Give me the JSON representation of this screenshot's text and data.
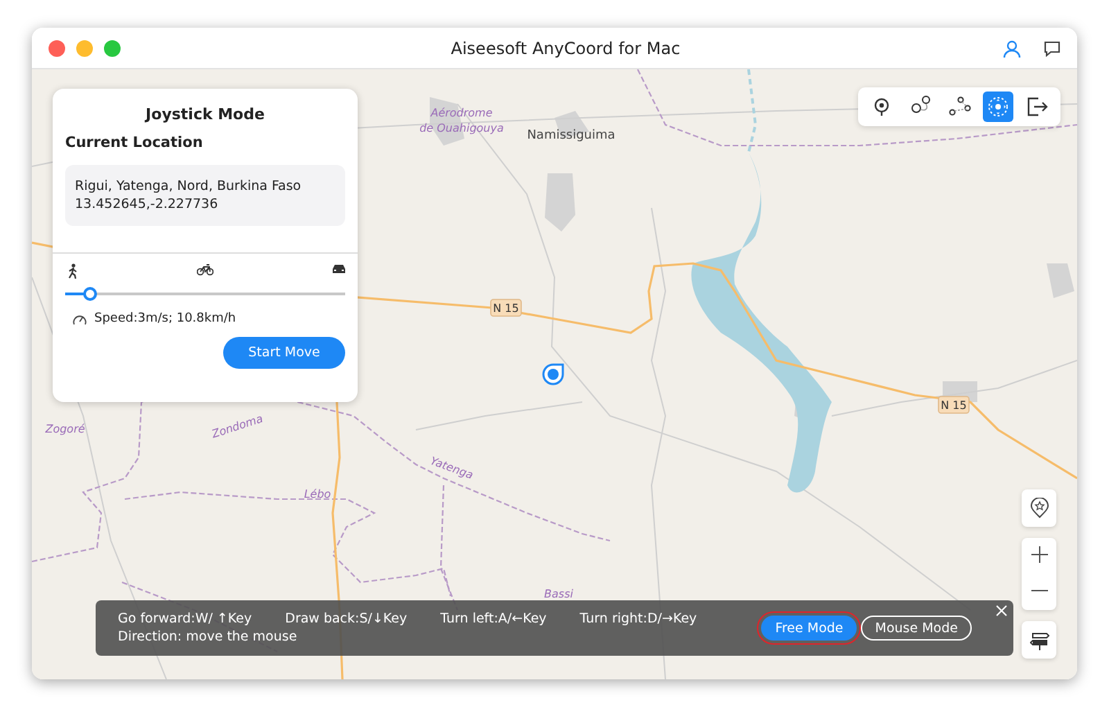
{
  "window": {
    "title": "Aiseesoft AnyCoord for Mac"
  },
  "map": {
    "labels": [
      {
        "kind": "region",
        "text": "Aérodrome"
      },
      {
        "kind": "region",
        "text": "de Ouahigouya"
      },
      {
        "kind": "place",
        "text": "Namissiguima"
      },
      {
        "kind": "shield",
        "text": "N 15"
      },
      {
        "kind": "shield",
        "text": "N 15"
      },
      {
        "kind": "region",
        "text": "Zogoré"
      },
      {
        "kind": "region",
        "text": "Zondoma"
      },
      {
        "kind": "region",
        "text": "Lébo"
      },
      {
        "kind": "region",
        "text": "Yatenga"
      },
      {
        "kind": "region",
        "text": "Bassi"
      }
    ]
  },
  "toolbar": {
    "tools": [
      {
        "selected": false
      },
      {
        "selected": false
      },
      {
        "selected": false
      },
      {
        "selected": true
      },
      {
        "selected": false
      }
    ]
  },
  "joystick_panel": {
    "title": "Joystick Mode",
    "heading": "Current Location",
    "address": "Rigui, Yatenga, Nord, Burkina Faso",
    "coordinates": "13.452645,-2.227736",
    "speed_slider": {
      "level": 0.09
    },
    "speed_text": "Speed:3m/s; 10.8km/h",
    "start_button": "Start Move"
  },
  "hint_bar": {
    "hints": [
      "Go forward:W/ ↑Key",
      "Draw back:S/↓Key",
      "Turn left:A/←Key",
      "Turn right:D/→Key"
    ],
    "direction": "Direction: move the mouse",
    "modes": [
      {
        "label": "Free Mode",
        "selected": true
      },
      {
        "label": "Mouse Mode",
        "selected": false
      }
    ]
  }
}
